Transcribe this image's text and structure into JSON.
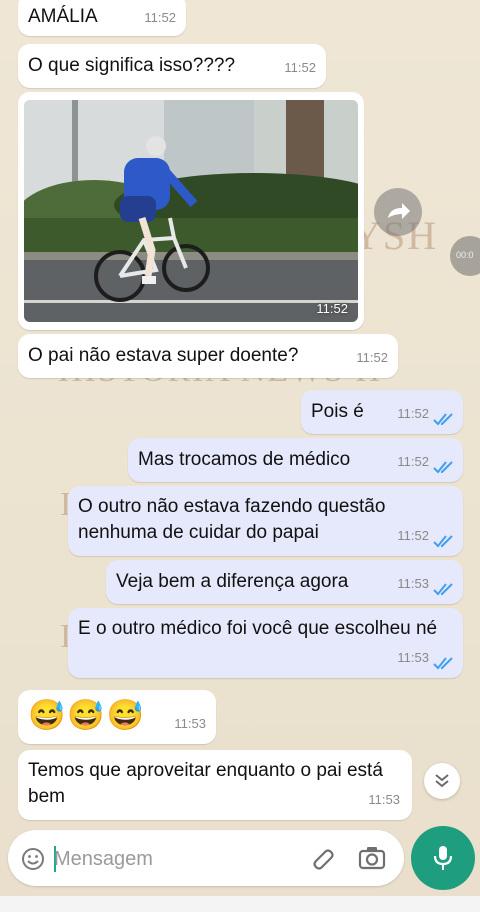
{
  "watermark": {
    "text_top": "YSH",
    "text_mid": "HISTORIA NEWS H",
    "letter": "I"
  },
  "messages": [
    {
      "id": "m0",
      "text": "AMÁLIA",
      "time": "11:52"
    },
    {
      "id": "m1",
      "text": "O que significa isso????",
      "time": "11:52"
    },
    {
      "id": "photo",
      "time": "11:52"
    },
    {
      "id": "m2",
      "text": "O pai não estava super doente?",
      "time": "11:52"
    },
    {
      "id": "m3",
      "text": "Pois é",
      "time": "11:52",
      "status": "read"
    },
    {
      "id": "m4",
      "text": "Mas trocamos de médico",
      "time": "11:52",
      "status": "read"
    },
    {
      "id": "m5",
      "text": "O outro não estava fazendo questão nenhuma de cuidar do papai",
      "time": "11:52",
      "status": "read"
    },
    {
      "id": "m6",
      "text": "Veja bem a diferença agora",
      "time": "11:53",
      "status": "read"
    },
    {
      "id": "m7",
      "text": "E o outro médico foi você que escolheu né",
      "time": "11:53",
      "status": "read"
    },
    {
      "id": "m8",
      "text": "😅😅😅",
      "time": "11:53"
    },
    {
      "id": "m9",
      "text": "Temos que aproveitar enquanto o pai está bem",
      "time": "11:53"
    }
  ],
  "side_pill_label": "00:0",
  "composer": {
    "placeholder": "Mensagem"
  },
  "icons": [
    "forward-icon",
    "emoji-icon",
    "attach-icon",
    "camera-icon",
    "mic-icon",
    "chevron-double-down-icon",
    "double-check-icon"
  ],
  "colors": {
    "incoming": "#ffffff",
    "outgoing": "#e6e8fb",
    "tick": "#3f9ff0",
    "mic": "#1f9e7f"
  }
}
